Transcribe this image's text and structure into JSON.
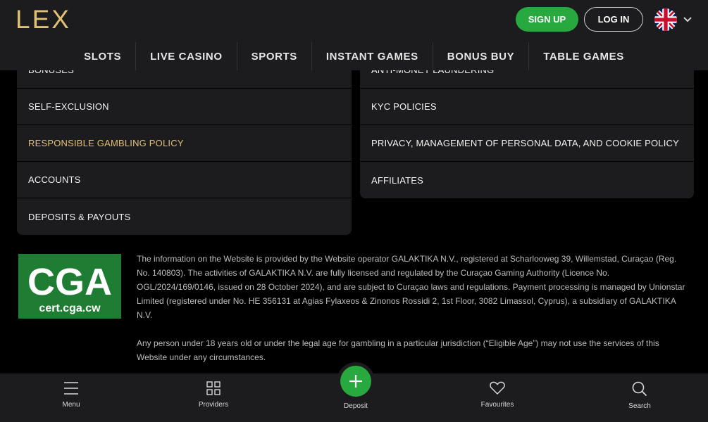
{
  "header": {
    "logo": "LEX",
    "signup_label": "SIGN UP",
    "login_label": "LOG IN",
    "language": "English (UK flag)"
  },
  "nav": [
    "SLOTS",
    "LIVE CASINO",
    "SPORTS",
    "INSTANT GAMES",
    "BONUS BUY",
    "TABLE GAMES"
  ],
  "links_left": [
    {
      "label": "BONUSES"
    },
    {
      "label": "SELF-EXCLUSION"
    },
    {
      "label": "RESPONSIBLE GAMBLING POLICY",
      "active": true
    },
    {
      "label": "ACCOUNTS"
    },
    {
      "label": "DEPOSITS & PAYOUTS"
    }
  ],
  "links_right": [
    {
      "label": "ANTI-MONEY LAUNDERING"
    },
    {
      "label": "KYC POLICIES"
    },
    {
      "label": "PRIVACY, MANAGEMENT OF PERSONAL DATA, AND COOKIE POLICY"
    },
    {
      "label": "AFFILIATES"
    }
  ],
  "license": {
    "badge_title": "CGA",
    "badge_sub": "cert.cga.cw",
    "paragraph1": "The information on the Website is provided by the Website operator GALAKTIKA N.V., registered at Scharlooweg 39, Willemstad, Curaçao (Reg. No. 140803). The activities of GALAKTIKA N.V. are fully licensed and regulated by the Curaçao Gaming Authority (Licence No. OGL/2024/169/0146, issued on 28 October 2024), and are subject to Curaçao laws and regulations. Payment processing is managed by Unionstar Limited (registered under No. HE 356131 at Agias Fylaxeos & Zinonos Rossidi 2, 1st Floor, 3082 Limassol, Cyprus), a subsidiary of GALAKTIKA N.V.",
    "paragraph2": "Any person under 18 years old or under the legal age for gambling in a particular jurisdiction (“Eligible Age”) may not use the services of this Website under any circumstances."
  },
  "bottom_nav": {
    "menu": "Menu",
    "providers": "Providers",
    "deposit": "Deposit",
    "favourites": "Favourites",
    "search": "Search"
  },
  "colors": {
    "accent_green": "#27a940",
    "gold": "#e2c074",
    "panel": "#1c1c1e",
    "background": "#000000"
  }
}
